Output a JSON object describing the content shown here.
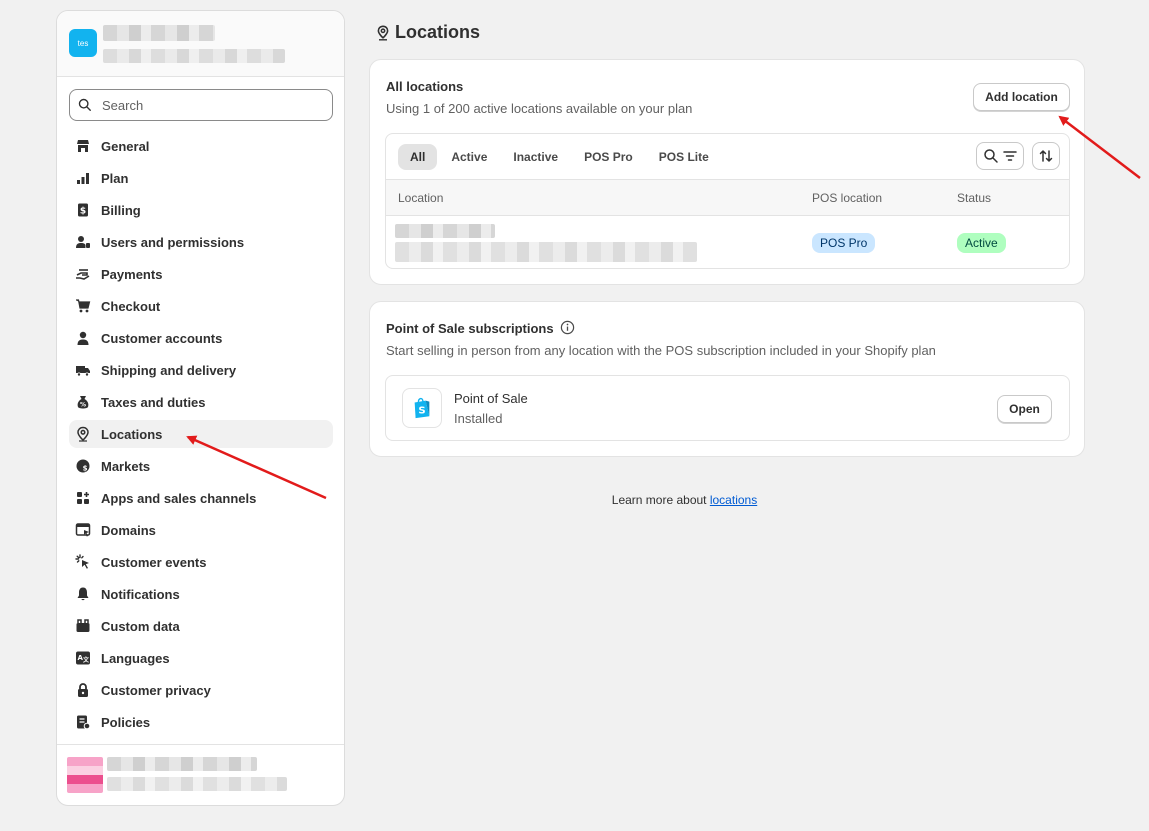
{
  "sidebar": {
    "store_initials": "tes",
    "search_placeholder": "Search",
    "items": [
      {
        "label": "General",
        "icon": "store-icon"
      },
      {
        "label": "Plan",
        "icon": "plan-icon"
      },
      {
        "label": "Billing",
        "icon": "billing-icon"
      },
      {
        "label": "Users and permissions",
        "icon": "users-icon"
      },
      {
        "label": "Payments",
        "icon": "payments-icon"
      },
      {
        "label": "Checkout",
        "icon": "cart-icon"
      },
      {
        "label": "Customer accounts",
        "icon": "person-icon"
      },
      {
        "label": "Shipping and delivery",
        "icon": "truck-icon"
      },
      {
        "label": "Taxes and duties",
        "icon": "taxes-icon"
      },
      {
        "label": "Locations",
        "icon": "location-icon",
        "active": true
      },
      {
        "label": "Markets",
        "icon": "globe-icon"
      },
      {
        "label": "Apps and sales channels",
        "icon": "apps-icon"
      },
      {
        "label": "Domains",
        "icon": "domains-icon"
      },
      {
        "label": "Customer events",
        "icon": "cursor-icon"
      },
      {
        "label": "Notifications",
        "icon": "bell-icon"
      },
      {
        "label": "Custom data",
        "icon": "custom-data-icon"
      },
      {
        "label": "Languages",
        "icon": "language-icon"
      },
      {
        "label": "Customer privacy",
        "icon": "lock-icon"
      },
      {
        "label": "Policies",
        "icon": "policies-icon"
      }
    ]
  },
  "page": {
    "title": "Locations"
  },
  "all_locations": {
    "title": "All locations",
    "subtitle": "Using 1 of 200 active locations available on your plan",
    "add_button": "Add location",
    "tabs": [
      "All",
      "Active",
      "Inactive",
      "POS Pro",
      "POS Lite"
    ],
    "selected_tab": "All",
    "columns": {
      "location": "Location",
      "pos": "POS location",
      "status": "Status"
    },
    "row": {
      "pos": "POS Pro",
      "status": "Active"
    }
  },
  "pos_subscriptions": {
    "title": "Point of Sale subscriptions",
    "subtitle": "Start selling in person from any location with the POS subscription included in your Shopify plan",
    "app_name": "Point of Sale",
    "app_status": "Installed",
    "open_button": "Open"
  },
  "footer": {
    "learn_text": "Learn more about",
    "learn_link": "locations"
  },
  "colors": {
    "pos_badge_bg": "#cae6ff",
    "active_badge_bg": "#affebf",
    "link": "#005bd3",
    "arrow": "#e21b1b"
  }
}
